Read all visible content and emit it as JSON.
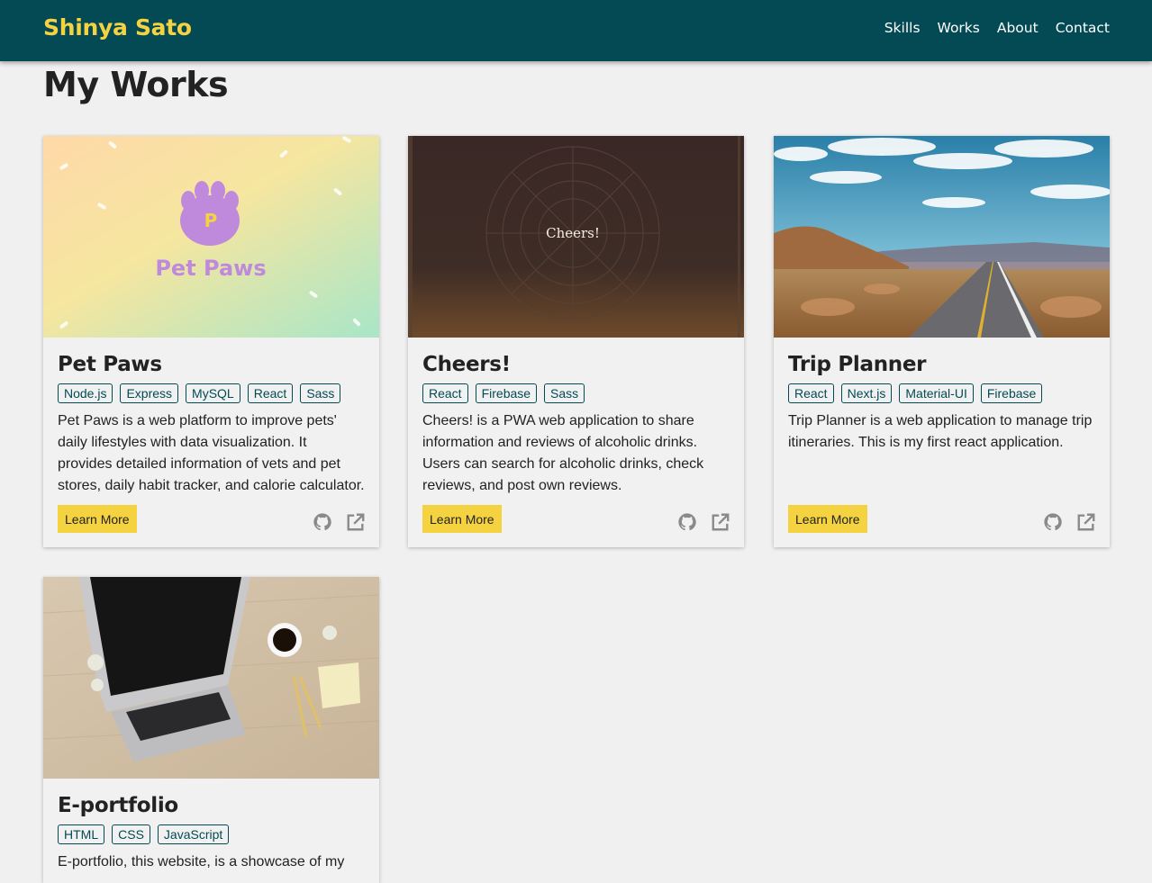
{
  "navbar": {
    "brand": "Shinya Sato",
    "links": [
      {
        "label": "Skills"
      },
      {
        "label": "Works"
      },
      {
        "label": "About"
      },
      {
        "label": "Contact"
      }
    ]
  },
  "page": {
    "title": "My Works"
  },
  "colors": {
    "nav_bg": "#034a54",
    "accent": "#f5d340",
    "page_bg": "#f0f0f0"
  },
  "works": [
    {
      "title": "Pet Paws",
      "tags": [
        "Node.js",
        "Express",
        "MySQL",
        "React",
        "Sass"
      ],
      "description": "Pet Paws is a web platform to improve pets' daily lifestyles with data visualization. It provides detailed information of vets and pet stores, daily habit tracker, and calorie calculator.",
      "image_text": "Pet Paws",
      "learn_more": "Learn More",
      "icons": [
        "github-icon",
        "external-link-icon"
      ]
    },
    {
      "title": "Cheers!",
      "tags": [
        "React",
        "Firebase",
        "Sass"
      ],
      "description": "Cheers! is a PWA web application to share information and reviews of alcoholic drinks. Users can search for alcoholic drinks, check reviews, and post own reviews.",
      "image_text": "Cheers!",
      "learn_more": "Learn More",
      "icons": [
        "github-icon",
        "external-link-icon"
      ]
    },
    {
      "title": "Trip Planner",
      "tags": [
        "React",
        "Next.js",
        "Material-UI",
        "Firebase"
      ],
      "description": "Trip Planner is a web application to manage trip itineraries. This is my first react application.",
      "learn_more": "Learn More",
      "icons": [
        "github-icon",
        "external-link-icon"
      ]
    },
    {
      "title": "E-portfolio",
      "tags": [
        "HTML",
        "CSS",
        "JavaScript"
      ],
      "description": "E-portfolio, this website, is a showcase of my"
    }
  ]
}
